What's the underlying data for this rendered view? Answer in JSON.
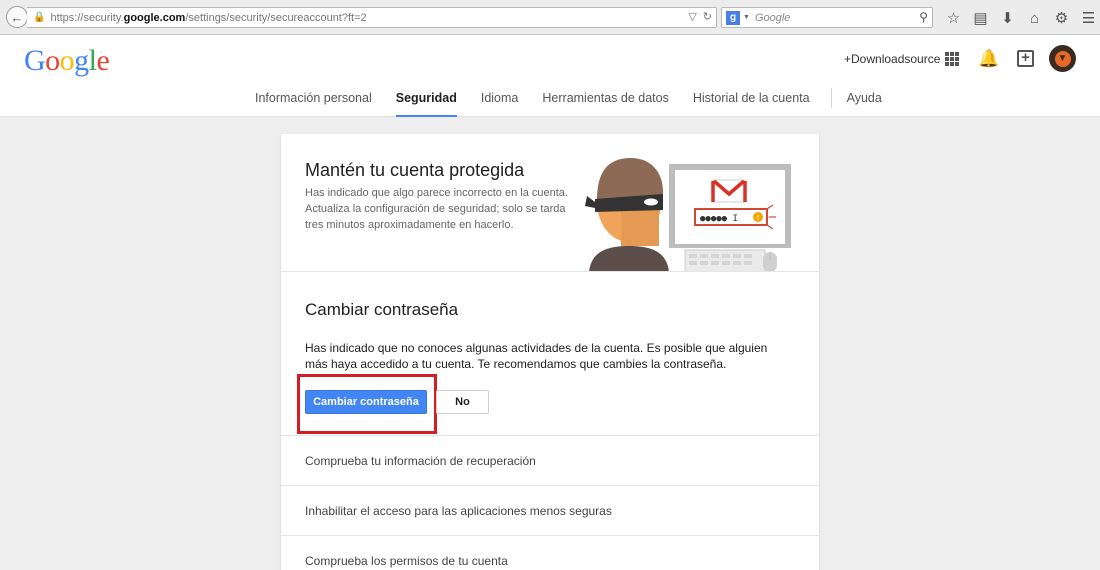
{
  "browser": {
    "url_prefix": "https://security.",
    "url_domain": "google.com",
    "url_suffix": "/settings/security/secureaccount?ft=2",
    "search_placeholder": "Google",
    "search_engine_letter": "g"
  },
  "header": {
    "logo": [
      "G",
      "o",
      "o",
      "g",
      "l",
      "e"
    ],
    "plus_link": "+Downloadsource"
  },
  "tabs": [
    {
      "label": "Información personal"
    },
    {
      "label": "Seguridad"
    },
    {
      "label": "Idioma"
    },
    {
      "label": "Herramientas de datos"
    },
    {
      "label": "Historial de la cuenta"
    },
    {
      "label": "Ayuda"
    }
  ],
  "active_tab": "Seguridad",
  "hero": {
    "title": "Mantén tu cuenta protegida",
    "description": "Has indicado que algo parece incorrecto en la cuenta. Actualiza la configuración de seguridad; solo se tarda tres minutos aproximadamente en hacerlo.",
    "password_mask": "●●●●● I"
  },
  "change_password": {
    "title": "Cambiar contraseña",
    "description": "Has indicado que no conoces algunas actividades de la cuenta. Es posible que alguien más haya accedido a tu cuenta. Te recomendamos que cambies la contraseña.",
    "primary_button": "Cambiar contraseña",
    "secondary_button": "No"
  },
  "rows": [
    {
      "label": "Comprueba tu información de recuperación"
    },
    {
      "label": "Inhabilitar el acceso para las aplicaciones menos seguras"
    },
    {
      "label": "Comprueba los permisos de tu cuenta"
    }
  ],
  "colors": {
    "accent": "#4285f4",
    "highlight": "#d41d25"
  }
}
